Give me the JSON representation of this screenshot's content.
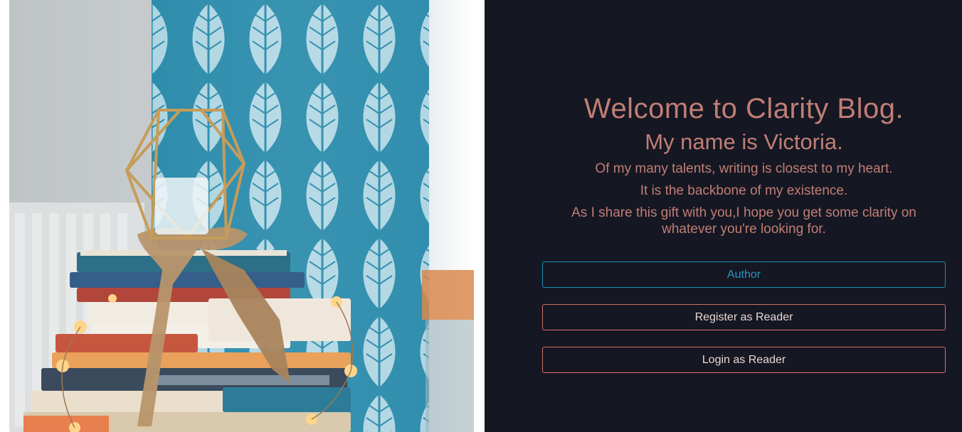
{
  "hero": {
    "image": "stack-of-books-with-lantern-and-curtains"
  },
  "intro": {
    "title": "Welcome to Clarity Blog.",
    "name": "My name is Victoria.",
    "line1": "Of my many talents, writing is closest to my heart.",
    "line2": "It is the backbone of my existence.",
    "line3": "As I share this gift with you,I hope you get some clarity on whatever you're looking for."
  },
  "buttons": {
    "author": "Author",
    "register": "Register as Reader",
    "login": "Login as Reader"
  },
  "colors": {
    "panel_bg": "#151722",
    "accent_text": "#c07e76",
    "author_border": "#1c8fb8",
    "reader_border": "#d9706c"
  }
}
